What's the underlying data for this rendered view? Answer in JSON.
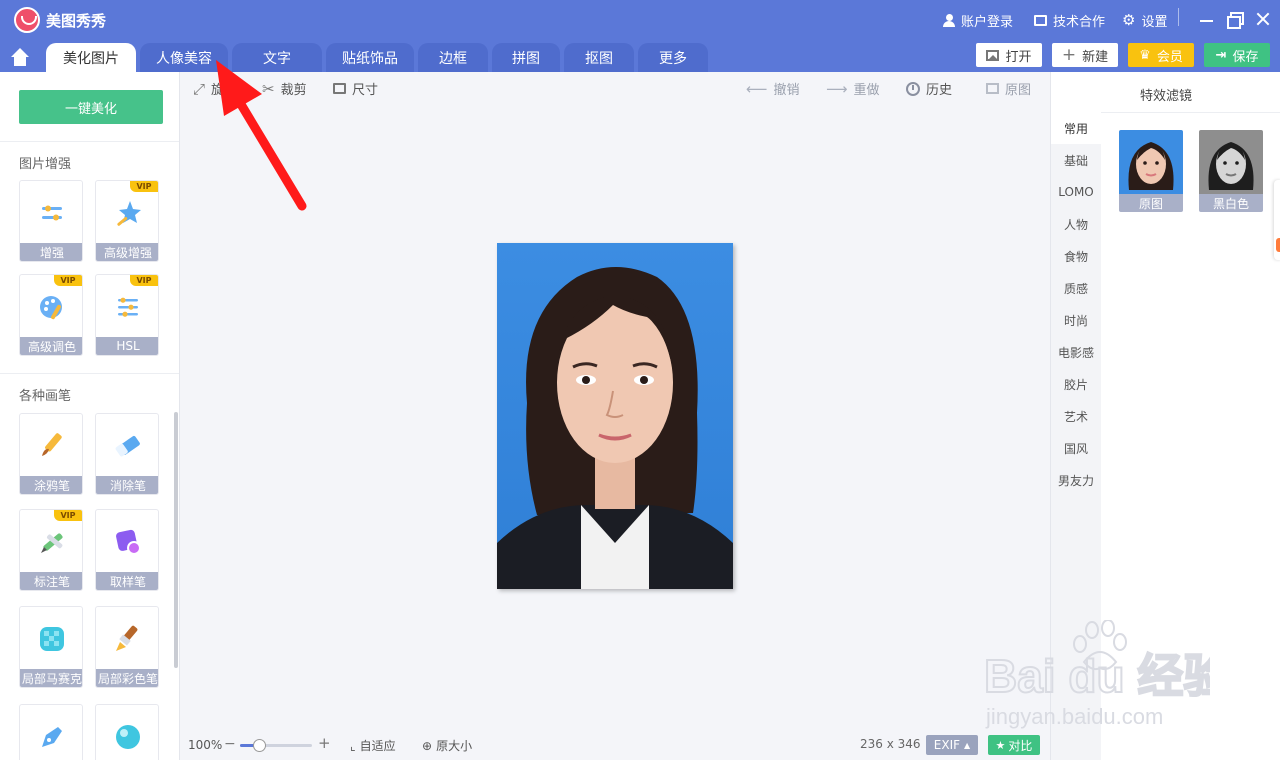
{
  "app": {
    "title": "美图秀秀"
  },
  "header": {
    "login_label": "账户登录",
    "cooperation_label": "技术合作",
    "settings_label": "设置"
  },
  "tabs": [
    {
      "label": "美化图片"
    },
    {
      "label": "人像美容"
    },
    {
      "label": "文字"
    },
    {
      "label": "贴纸饰品"
    },
    {
      "label": "边框"
    },
    {
      "label": "拼图"
    },
    {
      "label": "抠图"
    },
    {
      "label": "更多"
    }
  ],
  "toolbar": {
    "open_label": "打开",
    "new_label": "新建",
    "vip_label": "会员",
    "save_label": "保存"
  },
  "left_panel": {
    "oneclick_label": "一键美化",
    "enhance_title": "图片增强",
    "brush_title": "各种画笔",
    "vip_badge": "VIP",
    "enhance_tools": [
      {
        "label": "增强",
        "icon": "sliders-icon"
      },
      {
        "label": "高级增强",
        "icon": "magic-star-icon"
      },
      {
        "label": "高级调色",
        "icon": "palette-icon"
      },
      {
        "label": "HSL",
        "icon": "hsl-sliders-icon"
      }
    ],
    "brush_tools": [
      {
        "label": "涂鸦笔",
        "icon": "paint-brush-icon"
      },
      {
        "label": "消除笔",
        "icon": "eraser-icon"
      },
      {
        "label": "标注笔",
        "icon": "marker-pen-icon"
      },
      {
        "label": "取样笔",
        "icon": "sample-pen-icon"
      },
      {
        "label": "局部马赛克",
        "icon": "mosaic-icon"
      },
      {
        "label": "局部彩色笔",
        "icon": "color-brush-icon"
      }
    ]
  },
  "canvas_toolbar": {
    "rotate_label": "旋转",
    "crop_label": "裁剪",
    "resize_label": "尺寸",
    "undo_label": "撤销",
    "redo_label": "重做",
    "history_label": "历史",
    "original_label": "原图"
  },
  "canvas": {
    "zoom_label": "100%",
    "zoom_fraction": 0.27,
    "fit_label": "自适应",
    "actual_size_label": "原大小",
    "dimensions": "236 x 346",
    "exif_label": "EXIF",
    "compare_label": "对比"
  },
  "right_panel": {
    "title": "特效滤镜",
    "categories": [
      "常用",
      "基础",
      "LOMO",
      "人物",
      "食物",
      "质感",
      "时尚",
      "电影感",
      "胶片",
      "艺术",
      "国风",
      "男友力"
    ],
    "filters": [
      {
        "label": "原图"
      },
      {
        "label": "黑白色"
      }
    ]
  },
  "watermark": {
    "line1": "Bai du 经验",
    "line2": "jingyan.baidu.com"
  },
  "colors": {
    "titlebar": "#5b78d8",
    "accent_green": "#46c28a",
    "vip_yellow": "#f9c20f",
    "photo_background": "#3f8fe0",
    "annotation_arrow": "#ff1a1a"
  }
}
